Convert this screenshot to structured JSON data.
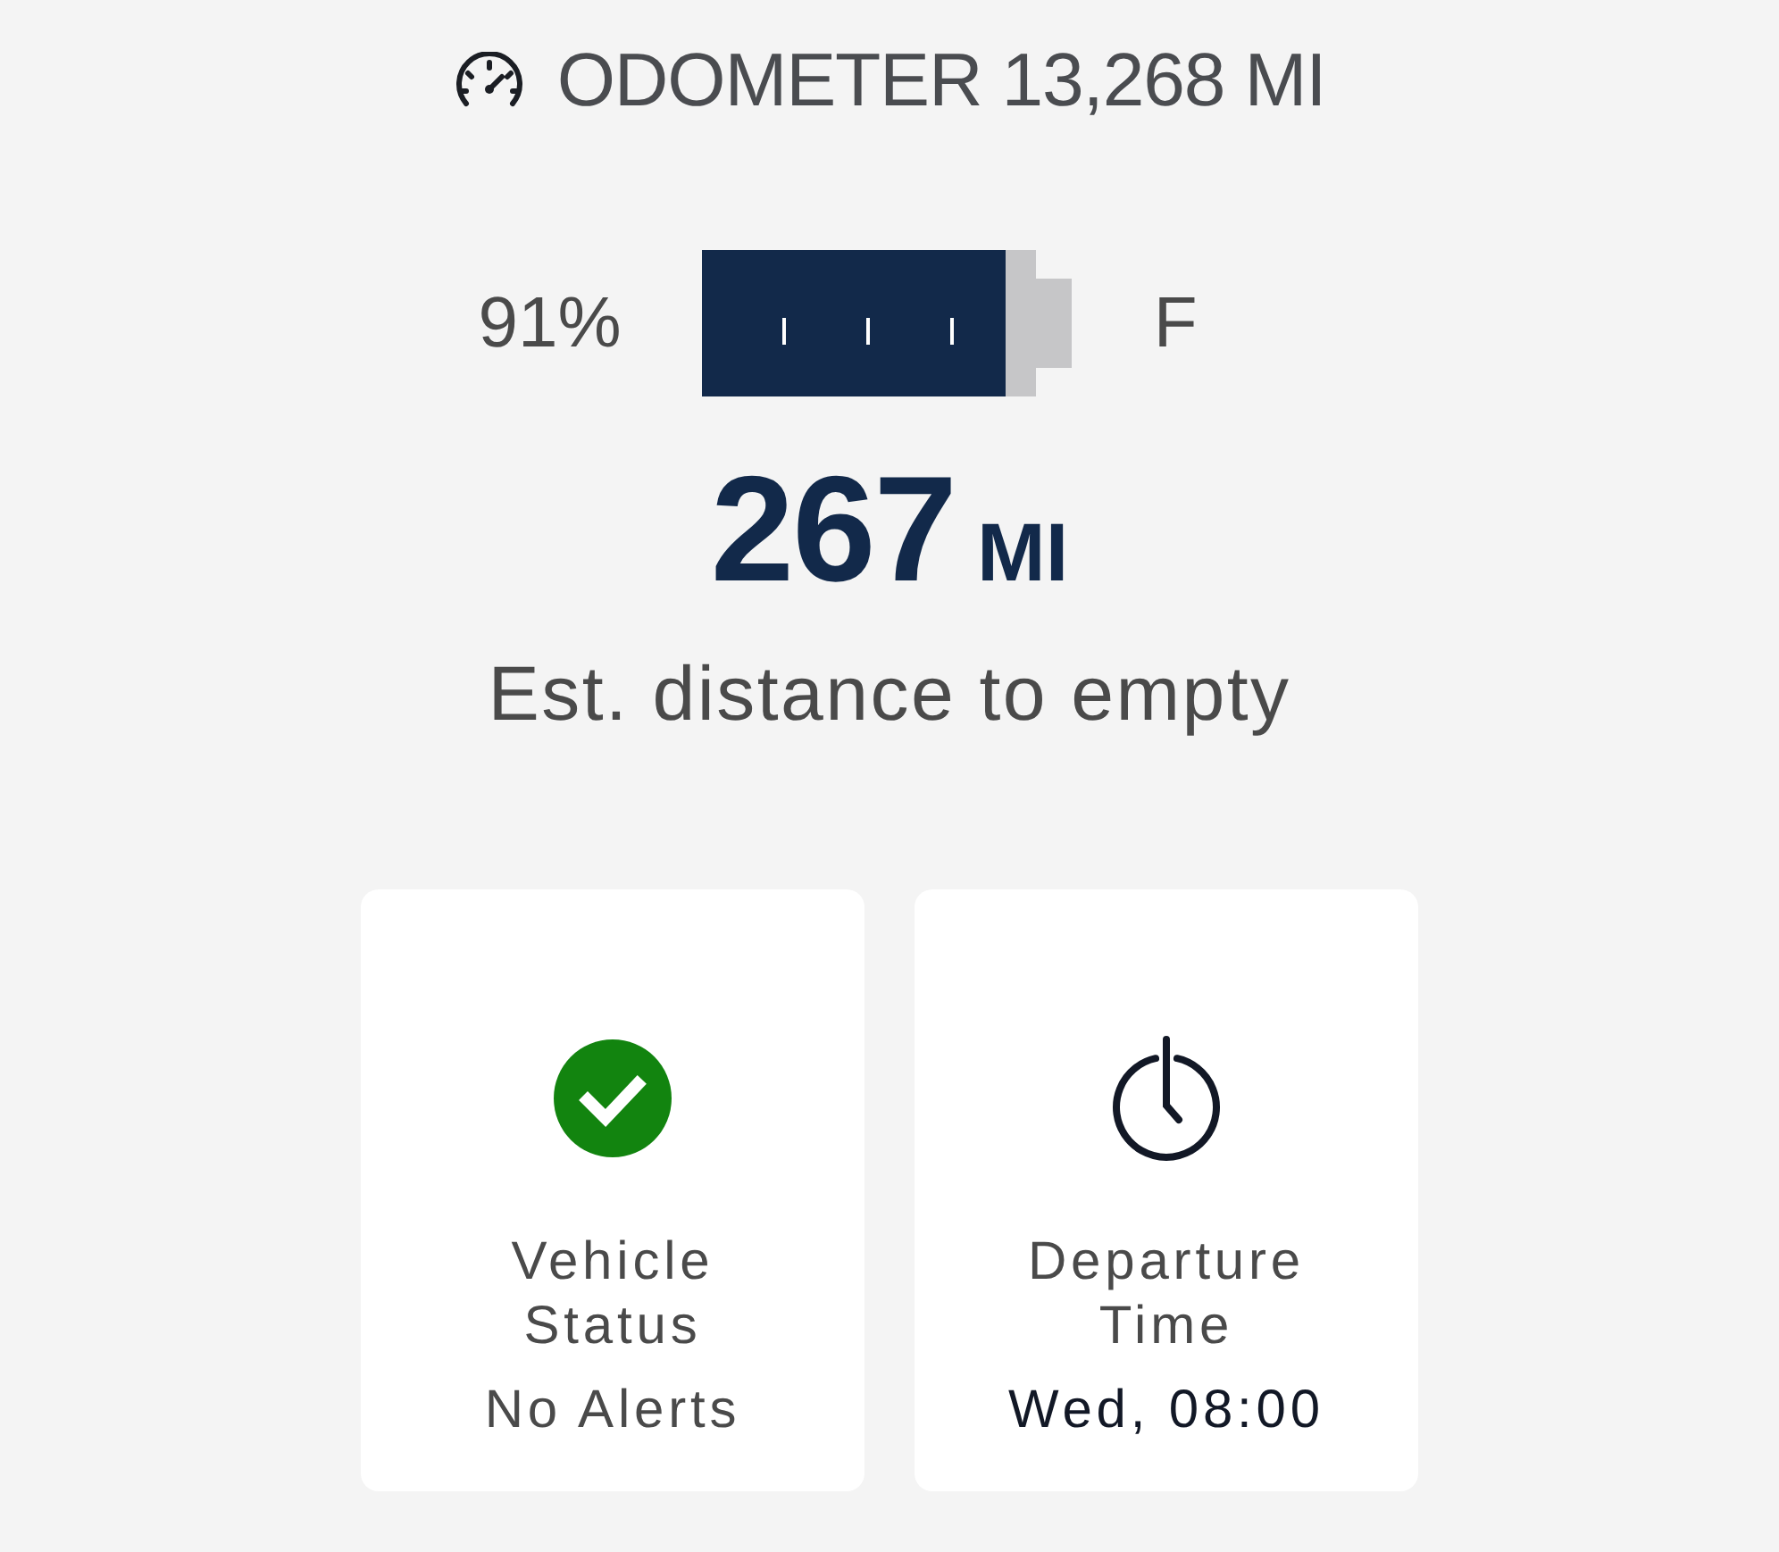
{
  "odometer": {
    "text": "ODOMETER 13,268 MI"
  },
  "charge": {
    "percent": "91%",
    "level": 0.91,
    "full_label": "F"
  },
  "range": {
    "value": "267",
    "unit": "MI",
    "caption": "Est. distance to empty"
  },
  "tiles": [
    {
      "kind": "vehicle_status",
      "title": "Vehicle Status",
      "value": "No Alerts"
    },
    {
      "kind": "departure_time",
      "title": "Departure Time",
      "value": "Wed, 08:00"
    }
  ]
}
